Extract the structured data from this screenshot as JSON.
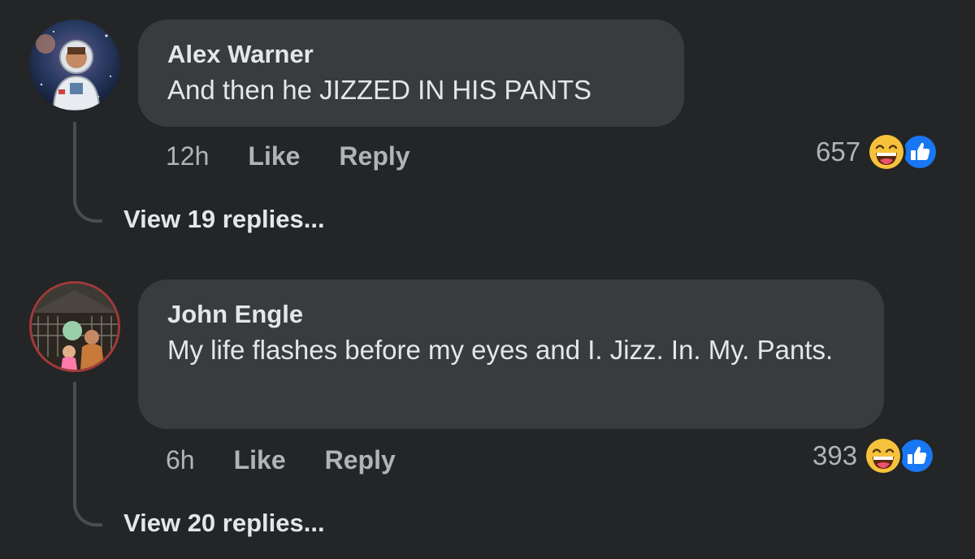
{
  "comments": [
    {
      "author": "Alex Warner",
      "text": "And then he JIZZED IN HIS PANTS",
      "time": "12h",
      "like_label": "Like",
      "reply_label": "Reply",
      "reaction_count": "657",
      "reaction_icons": [
        "haha-icon",
        "like-icon"
      ],
      "view_replies": "View 19 replies..."
    },
    {
      "author": "John Engle",
      "text": "My life flashes before my eyes and I. Jizz. In. My. Pants.",
      "time": "6h",
      "like_label": "Like",
      "reply_label": "Reply",
      "reaction_count": "393",
      "reaction_icons": [
        "haha-icon",
        "like-icon"
      ],
      "view_replies": "View 20 replies..."
    }
  ],
  "colors": {
    "background": "#242526",
    "bubble": "#3a3b3c",
    "primary_text": "#e4e6eb",
    "secondary_text": "#b0b3b8",
    "like_blue": "#1877f2",
    "haha_yellow": "#f7c23b"
  }
}
